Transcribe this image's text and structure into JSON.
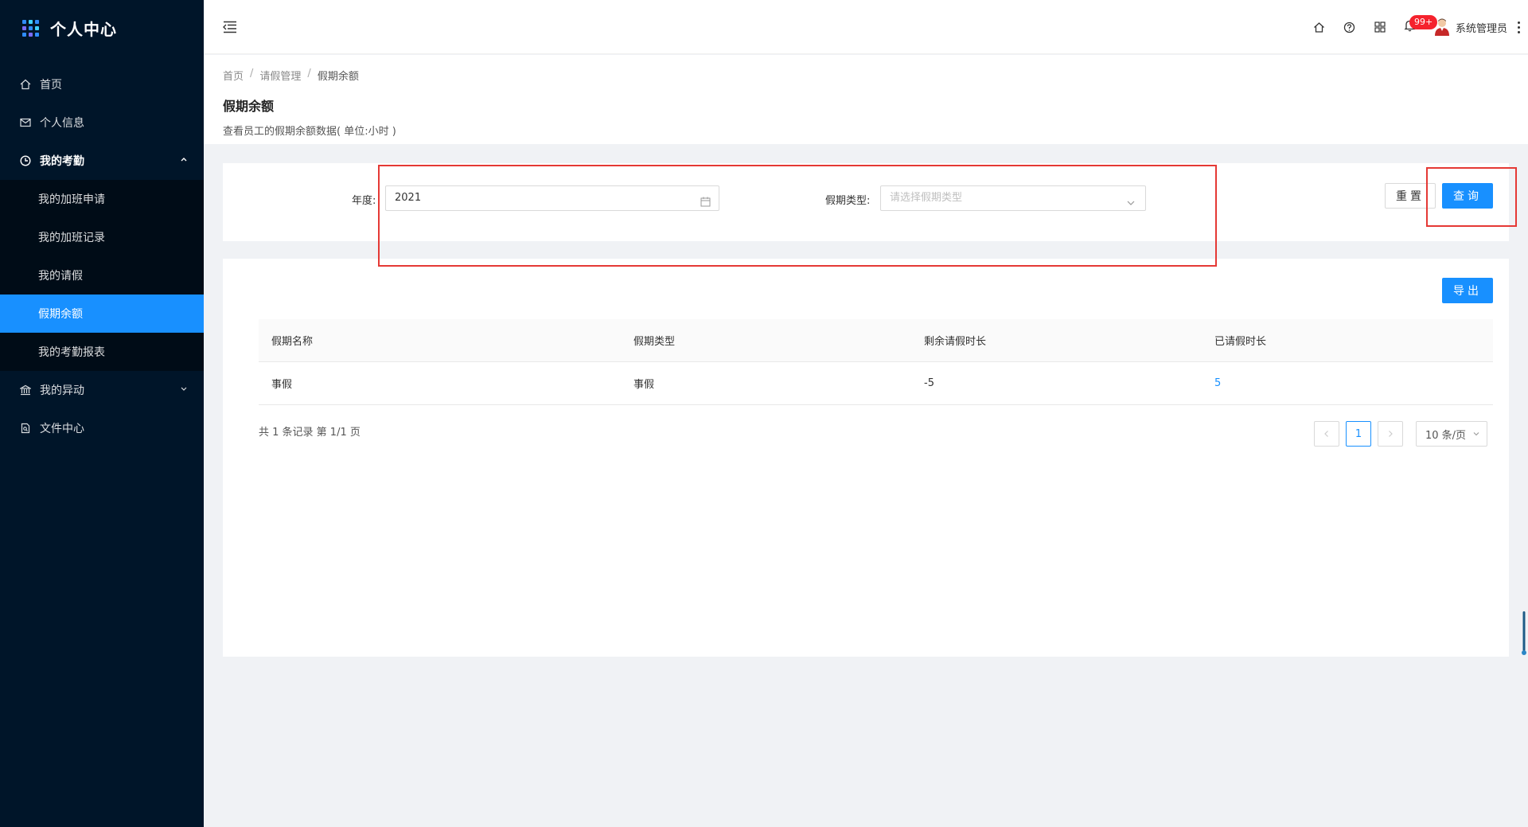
{
  "app": {
    "title": "个人中心"
  },
  "sidebar": {
    "items": [
      {
        "label": "首页",
        "icon": "home-icon"
      },
      {
        "label": "个人信息",
        "icon": "mail-icon"
      },
      {
        "label": "我的考勤",
        "icon": "clock-icon",
        "expanded": true
      },
      {
        "label": "我的异动",
        "icon": "bank-icon",
        "expanded": false
      },
      {
        "label": "文件中心",
        "icon": "file-icon"
      }
    ],
    "attendance_sub": [
      {
        "label": "我的加班申请"
      },
      {
        "label": "我的加班记录"
      },
      {
        "label": "我的请假"
      },
      {
        "label": "假期余额",
        "active": true
      },
      {
        "label": "我的考勤报表"
      }
    ]
  },
  "header": {
    "notification_badge": "99+",
    "username": "系统管理员"
  },
  "breadcrumb": {
    "home": "首页",
    "section": "请假管理",
    "current": "假期余额"
  },
  "page": {
    "title": "假期余额",
    "description": "查看员工的假期余额数据( 单位:小时 )"
  },
  "search": {
    "year_label": "年度:",
    "year_value": "2021",
    "type_label": "假期类型:",
    "type_placeholder": "请选择假期类型",
    "reset_label": "重置",
    "query_label": "查询"
  },
  "table": {
    "export_label": "导出",
    "columns": [
      "假期名称",
      "假期类型",
      "剩余请假时长",
      "已请假时长"
    ],
    "rows": [
      [
        "事假",
        "事假",
        "-5",
        "5"
      ]
    ]
  },
  "pagination": {
    "summary": "共 1 条记录 第 1/1 页",
    "current_page": "1",
    "page_size": "10 条/页"
  },
  "colors": {
    "primary": "#1890ff",
    "sidebar_bg": "#001529",
    "annotation": "#e53935"
  }
}
